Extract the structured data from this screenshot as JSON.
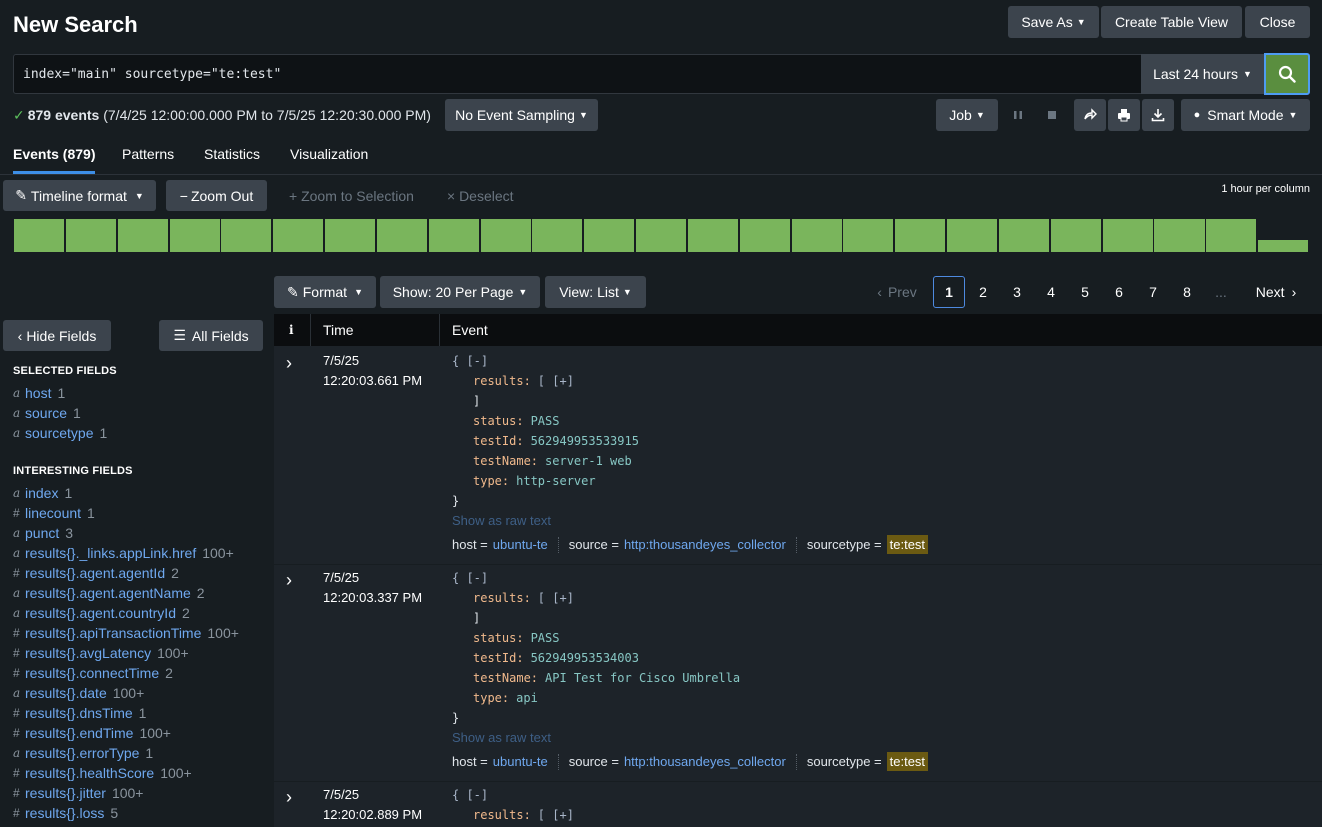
{
  "header": {
    "title": "New Search",
    "save_as": "Save As",
    "create_table_view": "Create Table View",
    "close": "Close"
  },
  "search": {
    "query": "index=\"main\" sourcetype=\"te:test\"",
    "time_range": "Last 24 hours"
  },
  "status": {
    "event_count": "879 events",
    "range": "(7/4/25 12:00:00.000 PM to 7/5/25 12:20:30.000 PM)",
    "sampling": "No Event Sampling",
    "job": "Job",
    "mode": "Smart Mode"
  },
  "tabs": [
    "Events (879)",
    "Patterns",
    "Statistics",
    "Visualization"
  ],
  "timeline": {
    "format": "Timeline format",
    "zoom_out": "Zoom Out",
    "zoom_selection": "+ Zoom to Selection",
    "deselect": "× Deselect",
    "scale": "1 hour per column",
    "columns": [
      1,
      1,
      1,
      1,
      1,
      1,
      1,
      1,
      1,
      1,
      1,
      1,
      1,
      1,
      1,
      1,
      1,
      1,
      1,
      1,
      1,
      1,
      1,
      1,
      0.36
    ]
  },
  "results_toolbar": {
    "format": "Format",
    "per_page": "Show: 20 Per Page",
    "view": "View: List",
    "prev": "Prev",
    "pages": [
      "1",
      "2",
      "3",
      "4",
      "5",
      "6",
      "7",
      "8",
      "..."
    ],
    "next": "Next"
  },
  "sidebar": {
    "hide_fields": "Hide Fields",
    "all_fields": "All Fields",
    "selected_title": "SELECTED FIELDS",
    "selected": [
      {
        "type": "a",
        "name": "host",
        "count": "1"
      },
      {
        "type": "a",
        "name": "source",
        "count": "1"
      },
      {
        "type": "a",
        "name": "sourcetype",
        "count": "1"
      }
    ],
    "interesting_title": "INTERESTING FIELDS",
    "interesting": [
      {
        "type": "a",
        "name": "index",
        "count": "1"
      },
      {
        "type": "#",
        "name": "linecount",
        "count": "1"
      },
      {
        "type": "a",
        "name": "punct",
        "count": "3"
      },
      {
        "type": "a",
        "name": "results{}._links.appLink.href",
        "count": "100+"
      },
      {
        "type": "#",
        "name": "results{}.agent.agentId",
        "count": "2"
      },
      {
        "type": "a",
        "name": "results{}.agent.agentName",
        "count": "2"
      },
      {
        "type": "a",
        "name": "results{}.agent.countryId",
        "count": "2"
      },
      {
        "type": "#",
        "name": "results{}.apiTransactionTime",
        "count": "100+"
      },
      {
        "type": "#",
        "name": "results{}.avgLatency",
        "count": "100+"
      },
      {
        "type": "#",
        "name": "results{}.connectTime",
        "count": "2"
      },
      {
        "type": "a",
        "name": "results{}.date",
        "count": "100+"
      },
      {
        "type": "#",
        "name": "results{}.dnsTime",
        "count": "1"
      },
      {
        "type": "#",
        "name": "results{}.endTime",
        "count": "100+"
      },
      {
        "type": "a",
        "name": "results{}.errorType",
        "count": "1"
      },
      {
        "type": "#",
        "name": "results{}.healthScore",
        "count": "100+"
      },
      {
        "type": "#",
        "name": "results{}.jitter",
        "count": "100+"
      },
      {
        "type": "#",
        "name": "results{}.loss",
        "count": "5"
      }
    ]
  },
  "table": {
    "col_info": "i",
    "col_time": "Time",
    "col_event": "Event",
    "raw_text": "Show as raw text",
    "events": [
      {
        "date": "7/5/25",
        "time": "12:20:03.661 PM",
        "status": "PASS",
        "testId": "562949953533915",
        "testName": "server-1 web",
        "type": "http-server",
        "host": "ubuntu-te",
        "source": "http:thousandeyes_collector",
        "sourcetype": "te:test"
      },
      {
        "date": "7/5/25",
        "time": "12:20:03.337 PM",
        "status": "PASS",
        "testId": "562949953534003",
        "testName": "API Test for Cisco Umbrella",
        "type": "api",
        "host": "ubuntu-te",
        "source": "http:thousandeyes_collector",
        "sourcetype": "te:test"
      },
      {
        "date": "7/5/25",
        "time": "12:20:02.889 PM"
      }
    ],
    "labels": {
      "open": "{ [-]",
      "results": "results:",
      "results_bracket": "[ [+]",
      "close_bracket": "]",
      "status": "status:",
      "testId": "testId:",
      "testName": "testName:",
      "type": "type:",
      "close_brace": "}",
      "host": "host =",
      "source": "source =",
      "sourcetype": "sourcetype ="
    }
  }
}
